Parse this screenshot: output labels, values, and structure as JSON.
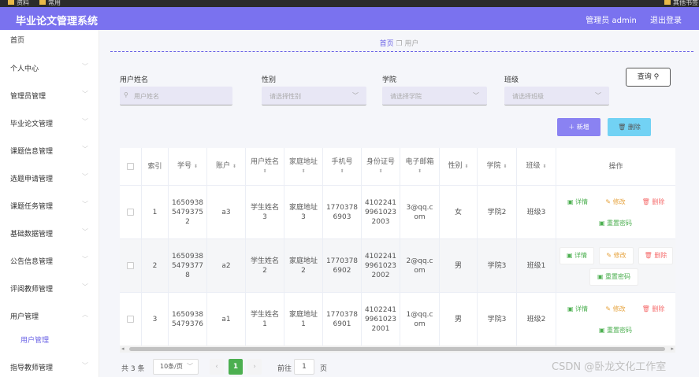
{
  "browser": {
    "bookmark_left_1": "资料",
    "bookmark_left_2": "常用",
    "bookmark_right": "其他书签"
  },
  "header": {
    "title": "毕业论文管理系统",
    "user": "管理员 admin",
    "logout": "退出登录"
  },
  "sidebar": {
    "home": "首页",
    "items": [
      "个人中心",
      "管理员管理",
      "毕业论文管理",
      "课题信息管理",
      "选题申请管理",
      "课题任务管理",
      "基础数据管理",
      "公告信息管理",
      "评阅教师管理",
      "用户管理",
      "指导教师管理"
    ],
    "sub_item": "用户管理"
  },
  "breadcrumb": {
    "home": "首页",
    "current": "用户"
  },
  "filters": {
    "name_label": "用户姓名",
    "name_placeholder": "用户姓名",
    "gender_label": "性别",
    "gender_placeholder": "请选择性别",
    "college_label": "学院",
    "college_placeholder": "请选择学院",
    "class_label": "班级",
    "class_placeholder": "请选择班级",
    "query_label": "查询"
  },
  "actions": {
    "add_label": "新增",
    "delete_label": "删除"
  },
  "table": {
    "columns": [
      "索引",
      "学号",
      "账户",
      "用户姓名",
      "家庭地址",
      "手机号",
      "身份证号",
      "电子邮箱",
      "性别",
      "学院",
      "班级",
      "操作"
    ],
    "rows": [
      {
        "index": "1",
        "student_no": "1650938\n5479375\n2",
        "account": "a3",
        "name": "学生姓名\n3",
        "address": "家庭地址\n3",
        "phone": "1770378\n6903",
        "id_card": "4102241\n9961023\n2003",
        "email": "3@qq.c\nom",
        "gender": "女",
        "college": "学院2",
        "class": "班级3"
      },
      {
        "index": "2",
        "student_no": "1650938\n5479377\n8",
        "account": "a2",
        "name": "学生姓名\n2",
        "address": "家庭地址\n2",
        "phone": "1770378\n6902",
        "id_card": "4102241\n9961023\n2002",
        "email": "2@qq.c\nom",
        "gender": "男",
        "college": "学院3",
        "class": "班级1"
      },
      {
        "index": "3",
        "student_no": "1650938\n5479376",
        "account": "a1",
        "name": "学生姓名\n1",
        "address": "家庭地址\n1",
        "phone": "1770378\n6901",
        "id_card": "4102241\n9961023\n2001",
        "email": "1@qq.c\nom",
        "gender": "男",
        "college": "学院3",
        "class": "班级2"
      }
    ],
    "op_detail": "详情",
    "op_edit": "修改",
    "op_delete": "删除",
    "op_reset": "重置密码"
  },
  "pagination": {
    "total": "共 3 条",
    "page_size": "10条/页",
    "current_page": "1",
    "goto_label": "前往",
    "goto_value": "1",
    "page_suffix": "页"
  },
  "watermark": "CSDN @卧龙文化工作室",
  "colors": {
    "header": "#7a72ef",
    "accent": "#6a62e6",
    "add_button": "#8a82f2",
    "delete_button": "#72d2f4",
    "page_active": "#4caf50"
  }
}
